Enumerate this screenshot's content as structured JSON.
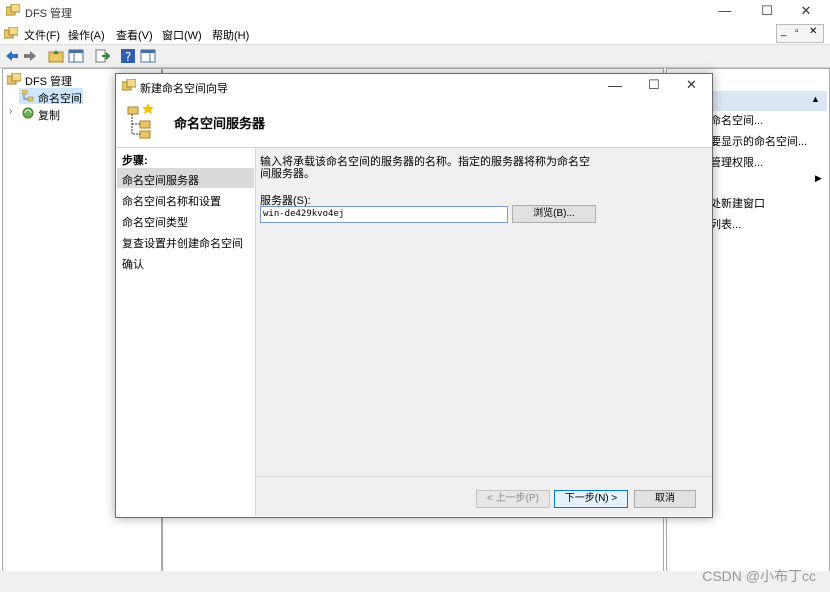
{
  "window": {
    "title": "DFS 管理",
    "minimize": "—",
    "maximize": "☐",
    "close": "✕"
  },
  "menu": {
    "items": [
      "文件(F)",
      "操作(A)",
      "查看(V)",
      "窗口(W)",
      "帮助(H)"
    ],
    "mdi": [
      "_",
      "▫",
      "✕"
    ]
  },
  "tree": {
    "root": "DFS 管理",
    "namespace": "命名空间",
    "replication": "复制"
  },
  "actions": {
    "header": "",
    "items": [
      "命名空间...",
      "要显示的命名空间...",
      "管理权限...",
      "",
      "处新建窗口",
      "列表...",
      ""
    ]
  },
  "dialog": {
    "title": "新建命名空间向导",
    "header": "命名空间服务器",
    "steps_label": "步骤:",
    "steps": [
      "命名空间服务器",
      "命名空间名称和设置",
      "命名空间类型",
      "复查设置并创建命名空间",
      "确认"
    ],
    "description": "输入将承载该命名空间的服务器的名称。指定的服务器将称为命名空间服务器。",
    "server_label": "服务器(S):",
    "server_value": "win-de429kvo4ej",
    "browse_label": "浏览(B)...",
    "prev_label": "< 上一步(P)",
    "next_label": "下一步(N) >",
    "cancel_label": "取消"
  },
  "watermark": "CSDN @小布丁cc"
}
